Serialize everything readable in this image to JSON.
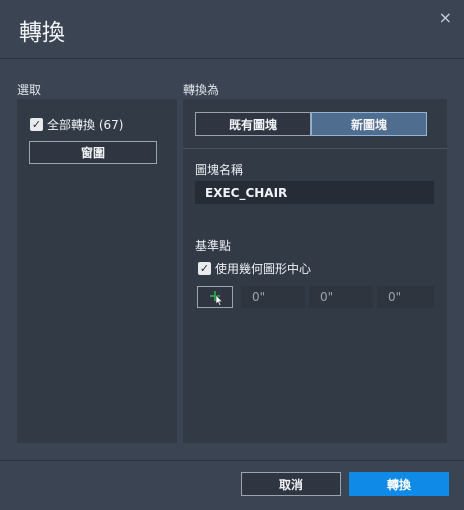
{
  "dialog": {
    "title": "轉換",
    "close_symbol": "×"
  },
  "selection": {
    "label": "選取",
    "convert_all_label": "全部轉換 (67)",
    "convert_all_checked": true,
    "fence_button": "窗圍"
  },
  "convert_to": {
    "label": "轉換為",
    "tabs": [
      {
        "label": "既有圖塊",
        "active": false
      },
      {
        "label": "新圖塊",
        "active": true
      }
    ],
    "block_name_label": "圖塊名稱",
    "block_name_value": "EXEC_CHAIR",
    "base_point_label": "基準點",
    "use_geometry_center_label": "使用幾何圖形中心",
    "use_geometry_center_checked": true,
    "coords": [
      "0\"",
      "0\"",
      "0\""
    ]
  },
  "footer": {
    "cancel_label": "取消",
    "convert_label": "轉換"
  },
  "colors": {
    "accent": "#0f8ae6",
    "background": "#3b4453",
    "panel": "#323a46",
    "pick_plus": "#2fbf4f"
  }
}
